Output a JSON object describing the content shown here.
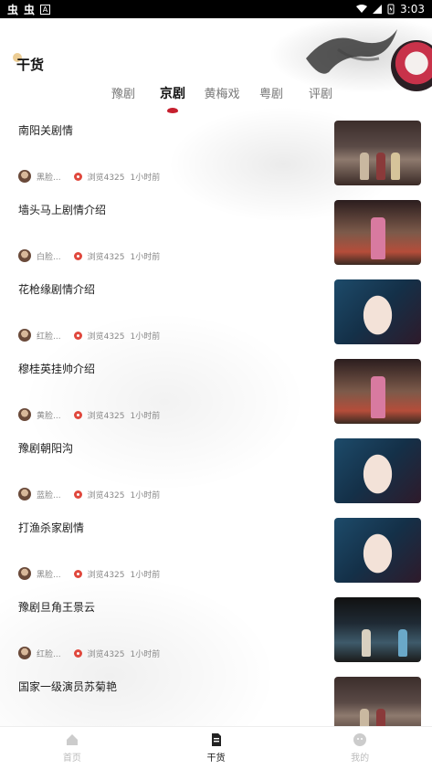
{
  "status_bar": {
    "left_icons": [
      "虫",
      "虫"
    ],
    "a_badge": "A",
    "time": "3:03"
  },
  "header": {
    "title": "干货"
  },
  "tabs": [
    {
      "label": "豫剧"
    },
    {
      "label": "京剧"
    },
    {
      "label": "黄梅戏"
    },
    {
      "label": "粤剧"
    },
    {
      "label": "评剧"
    }
  ],
  "active_tab": "京剧",
  "articles": [
    {
      "title": "南阳关剧情",
      "author": "黑脸...",
      "views": "浏览4325",
      "time": "1小时前",
      "thumb": "stage1"
    },
    {
      "title": "墙头马上剧情介绍",
      "author": "白脸...",
      "views": "浏览4325",
      "time": "1小时前",
      "thumb": "stage2"
    },
    {
      "title": "花枪缘剧情介绍",
      "author": "红脸...",
      "views": "浏览4325",
      "time": "1小时前",
      "thumb": "face"
    },
    {
      "title": "穆桂英挂帅介绍",
      "author": "黄脸...",
      "views": "浏览4325",
      "time": "1小时前",
      "thumb": "stage2"
    },
    {
      "title": "豫剧朝阳沟",
      "author": "蓝脸...",
      "views": "浏览4325",
      "time": "1小时前",
      "thumb": "face"
    },
    {
      "title": "打渔杀家剧情",
      "author": "黑脸...",
      "views": "浏览4325",
      "time": "1小时前",
      "thumb": "face"
    },
    {
      "title": "豫剧旦角王景云",
      "author": "红脸...",
      "views": "浏览4325",
      "time": "1小时前",
      "thumb": "stage3"
    },
    {
      "title": "国家一级演员苏菊艳",
      "author": "",
      "views": "",
      "time": "",
      "thumb": "stage1"
    }
  ],
  "bottom_nav": [
    {
      "label": "首页",
      "icon": "home-icon",
      "active": false
    },
    {
      "label": "干货",
      "icon": "document-icon",
      "active": true
    },
    {
      "label": "我的",
      "icon": "profile-icon",
      "active": false
    }
  ],
  "colors": {
    "accent": "#c61f2e",
    "views_icon": "#e0483d"
  }
}
